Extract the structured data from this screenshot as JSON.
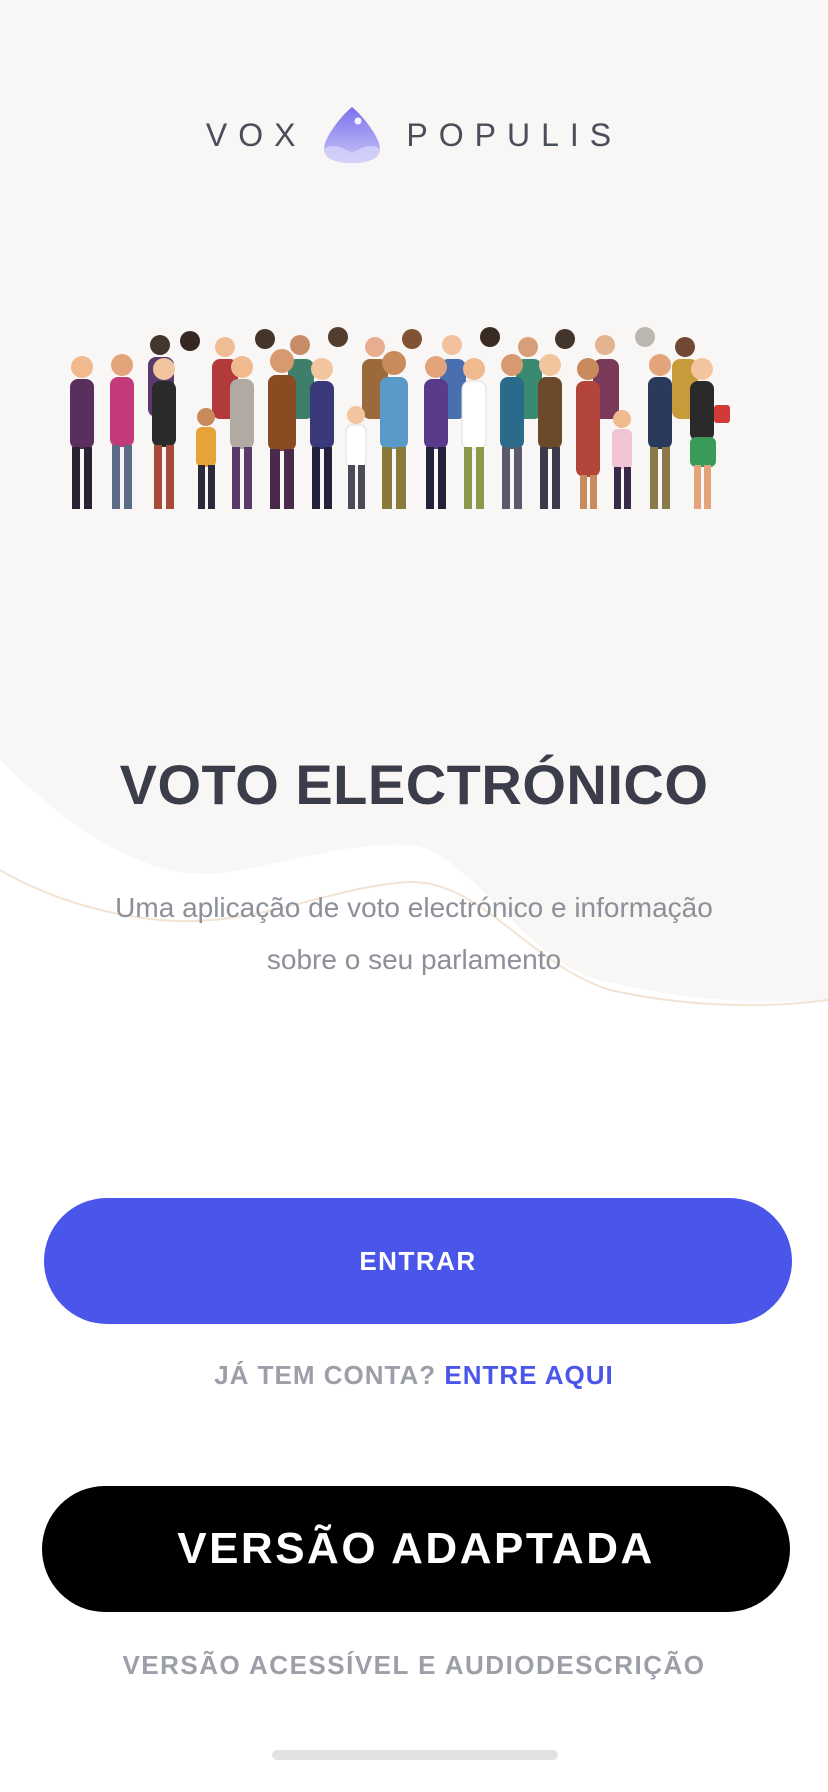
{
  "logo": {
    "left_word": "VOX",
    "right_word": "POPULIS",
    "icon": "droplet-logo-icon"
  },
  "hero": {
    "image": "crowd-of-people-illustration"
  },
  "title": "VOTO ELECTRÓNICO",
  "subtitle": "Uma aplicação de voto electrónico e informação sobre o seu parlamento",
  "primary_button": {
    "label": "ENTRAR"
  },
  "login": {
    "question": "JÁ TEM CONTA?",
    "link": "ENTRE AQUI"
  },
  "adapted_button": {
    "label": "VERSÃO ADAPTADA"
  },
  "accessibility_note": "VERSÃO ACESSÍVEL E AUDIODESCRIÇÃO",
  "colors": {
    "background_top": "#f9f7f5",
    "accent": "#4a56ea",
    "title": "#3b3d4a",
    "muted": "#9c9ea8",
    "wave_line": "#f3e3d3"
  }
}
